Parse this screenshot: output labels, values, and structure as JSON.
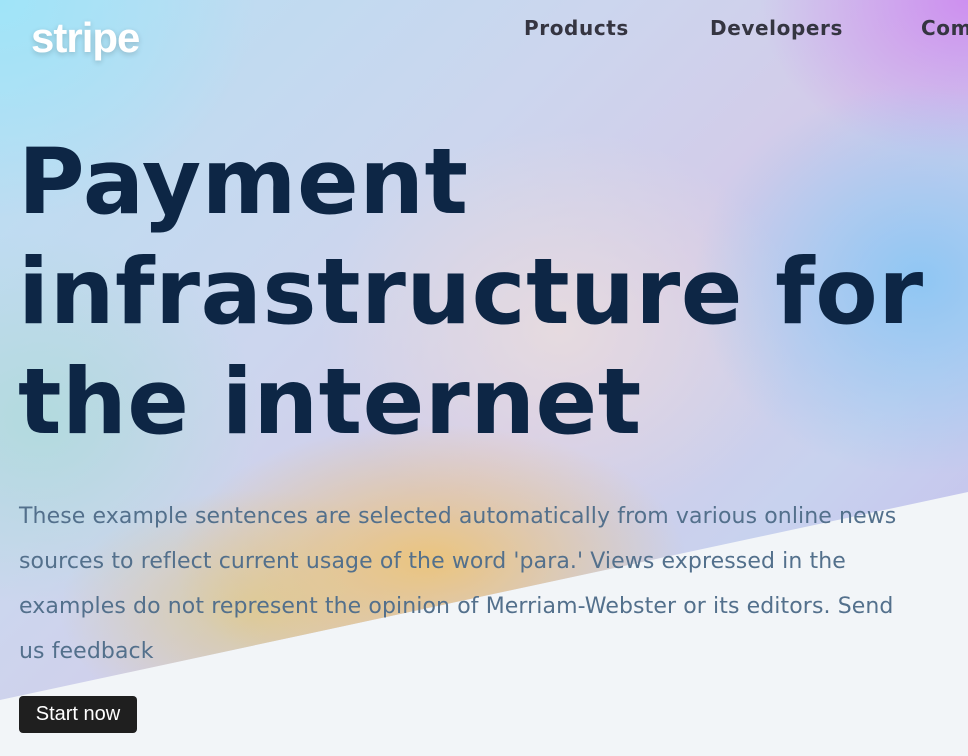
{
  "header": {
    "logo_text": "stripe",
    "nav": [
      {
        "label": "Products"
      },
      {
        "label": "Developers"
      },
      {
        "label": "Com"
      }
    ]
  },
  "hero": {
    "headline_lines": [
      "Payment",
      "infrastructure for",
      "the internet"
    ],
    "body": "These example sentences are selected automatically from various online news sources to reflect current usage of the word 'para.' Views expressed in the examples do not represent the opinion of Merriam-Webster or its editors. Send us feedback",
    "cta_label": "Start now"
  },
  "colors": {
    "headline": "#0d2645",
    "body_text": "#53708c",
    "nav_text": "#353541",
    "cta_bg": "#1f1f1f",
    "page_bg": "#f2f5f8"
  }
}
